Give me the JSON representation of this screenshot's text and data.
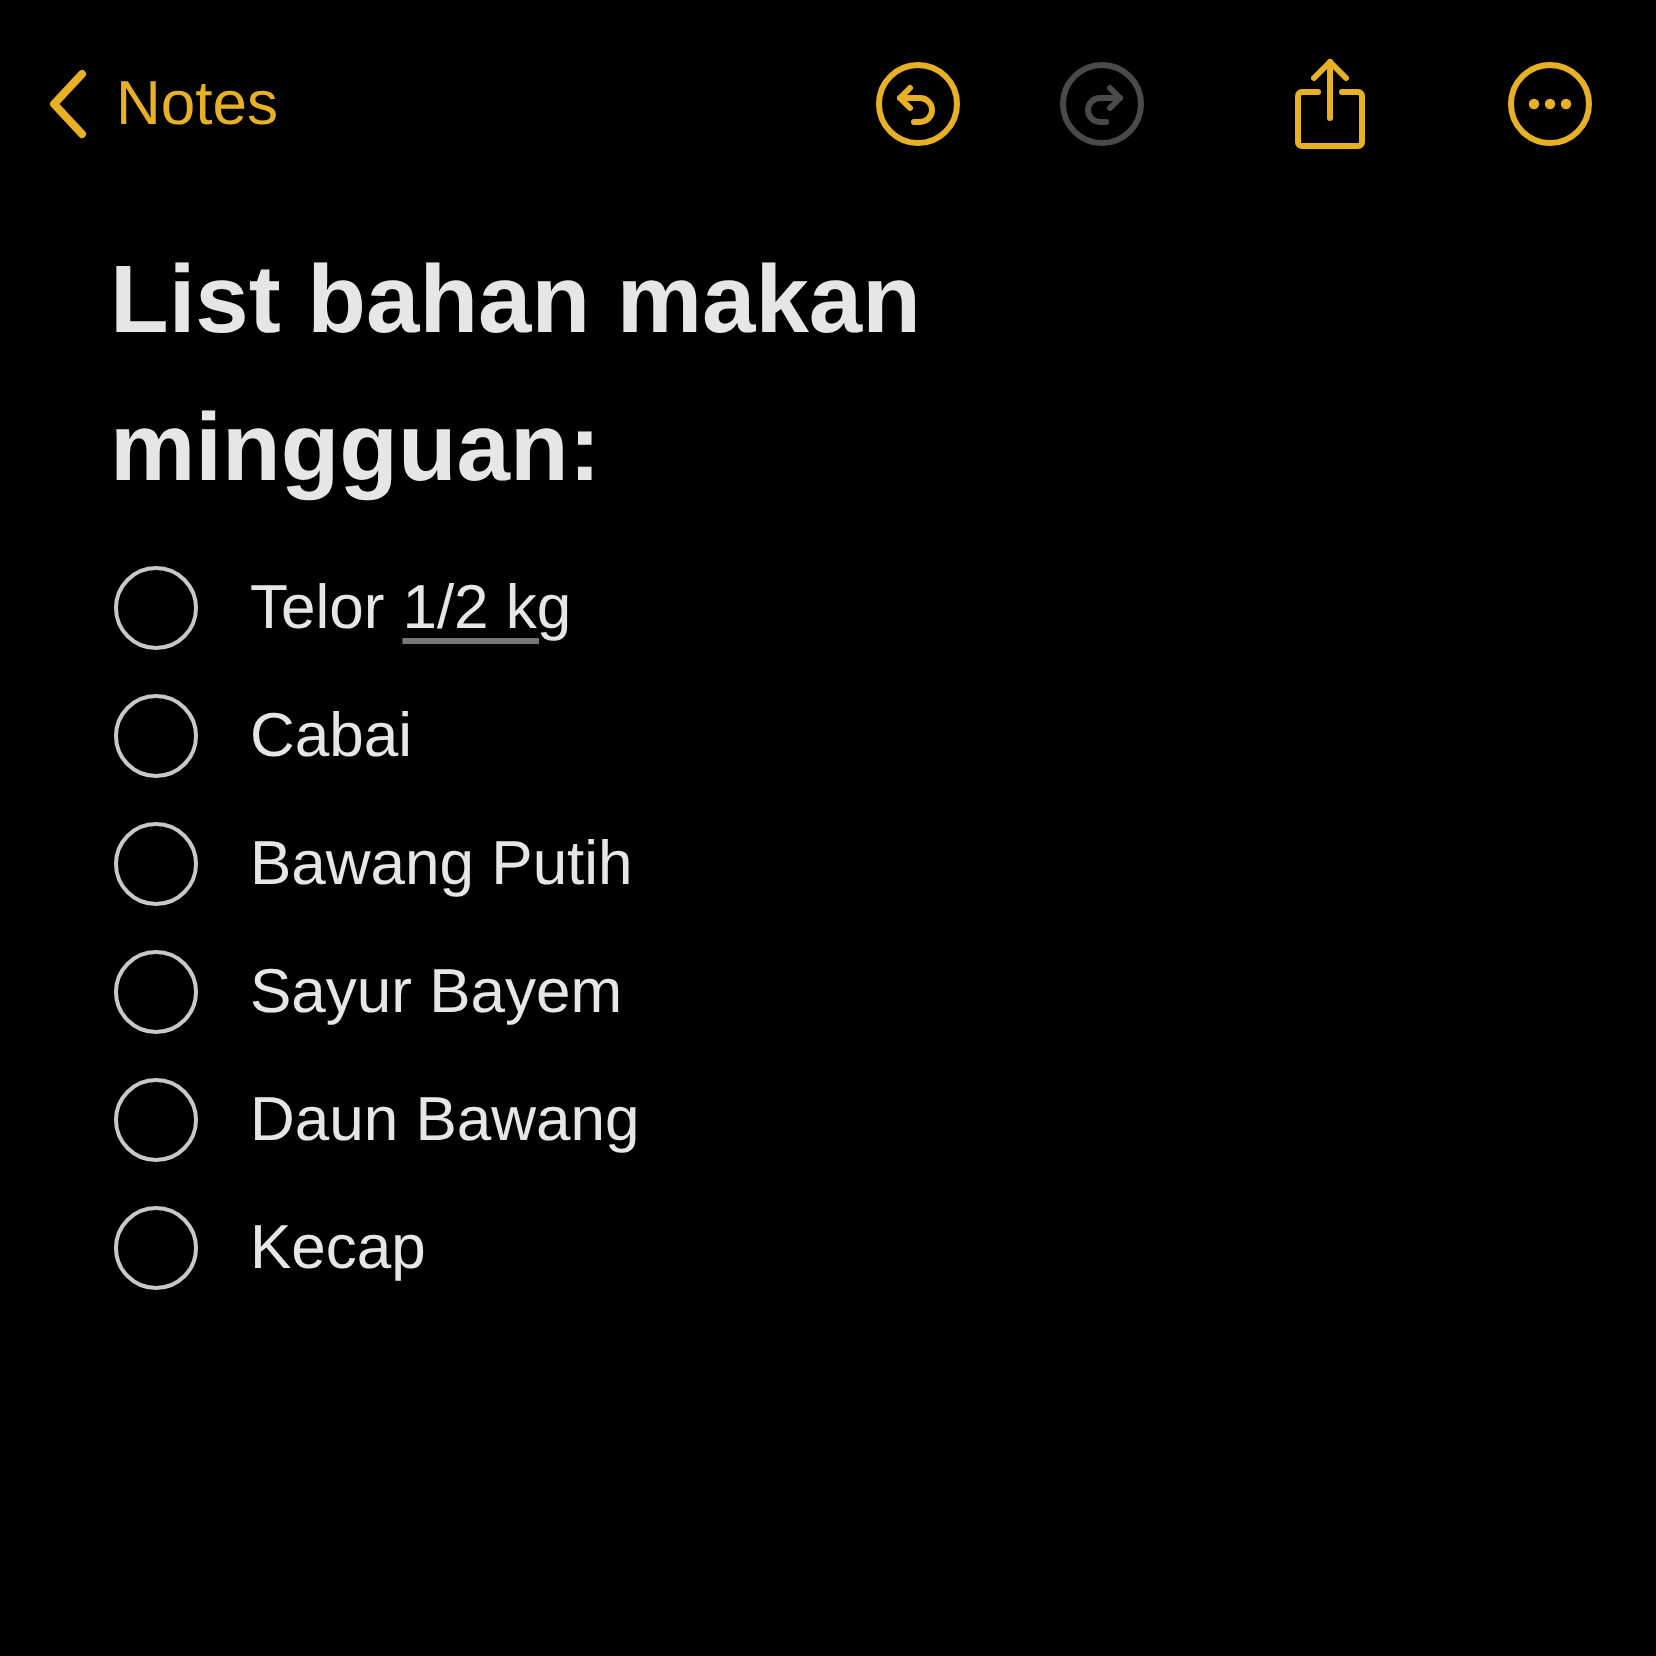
{
  "nav": {
    "back_label": "Notes",
    "actions": [
      {
        "kind": "undo",
        "disabled": false
      },
      {
        "kind": "redo",
        "disabled": true
      },
      {
        "kind": "share",
        "disabled": false
      },
      {
        "kind": "more",
        "disabled": false
      }
    ]
  },
  "note": {
    "title": "List bahan makan mingguan:",
    "checklist": [
      {
        "text": "Telor",
        "link": "1/2 kg",
        "checked": false
      },
      {
        "text": "Cabai",
        "checked": false
      },
      {
        "text": "Bawang Putih",
        "checked": false
      },
      {
        "text": "Sayur Bayem",
        "checked": false
      },
      {
        "text": "Daun Bawang",
        "checked": false
      },
      {
        "text": "Kecap",
        "checked": false
      }
    ]
  }
}
